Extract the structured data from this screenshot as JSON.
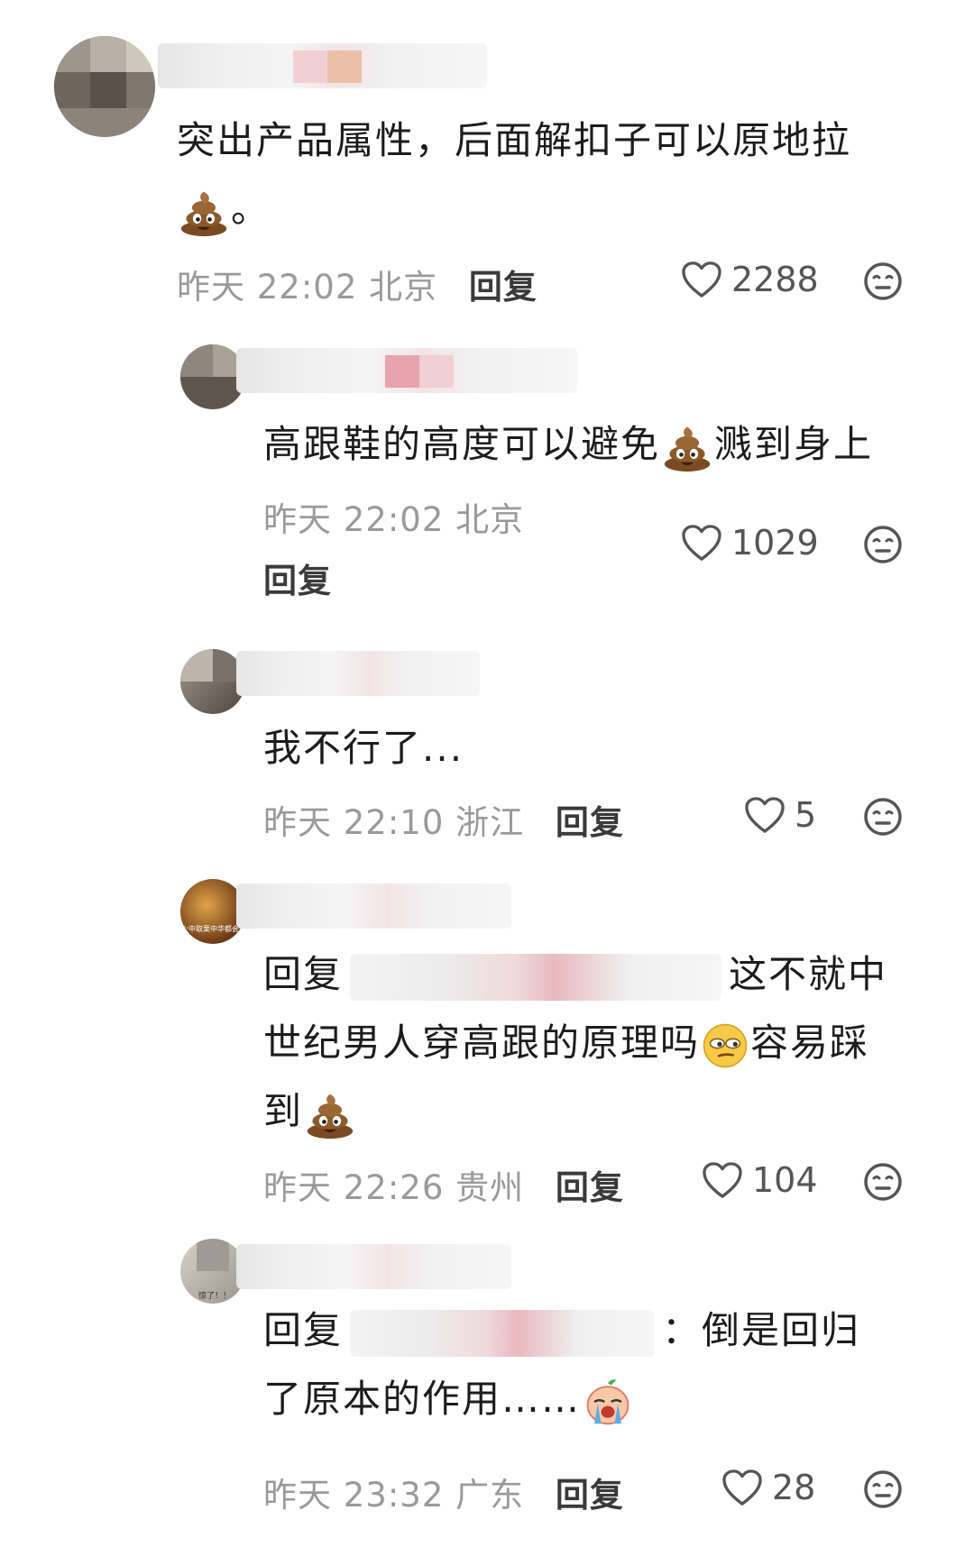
{
  "comments": [
    {
      "text_before": "突出产品属性，后面解扣子可以原地拉",
      "text_after": "。",
      "time": "昨天 22:02",
      "location": "北京",
      "reply_label": "回复",
      "likes": "2288"
    },
    {
      "text_before": "高跟鞋的高度可以避免",
      "text_after": "溅到身上",
      "time": "昨天 22:02",
      "location": "北京",
      "reply_label": "回复",
      "likes": "1029"
    },
    {
      "text": "我不行了...",
      "time": "昨天 22:10",
      "location": "浙江",
      "reply_label": "回复",
      "likes": "5"
    },
    {
      "reply_prefix": "回复",
      "text_1": "这不就中",
      "text_2": "世纪男人穿高跟的原理吗",
      "text_3": "容易踩",
      "text_4": "到",
      "time": "昨天 22:26",
      "location": "贵州",
      "reply_label": "回复",
      "likes": "104"
    },
    {
      "reply_prefix": "回复",
      "colon": "：",
      "text_1": "倒是回归",
      "text_2": "了原本的作用……",
      "time": "昨天 23:32",
      "location": "广东",
      "reply_label": "回复",
      "likes": "28"
    }
  ],
  "avatar_captions": {
    "c4": "火中取栗中华都会",
    "c5": "惊了！！"
  },
  "colors": {
    "text": "#1c1c1c",
    "meta": "#9a9a9a",
    "icon": "#555555",
    "poop": "#8b5a2b"
  },
  "icons": [
    "poop-emoji",
    "smirk-emoji",
    "crying-emoji",
    "heart-icon",
    "dislike-face-icon"
  ]
}
